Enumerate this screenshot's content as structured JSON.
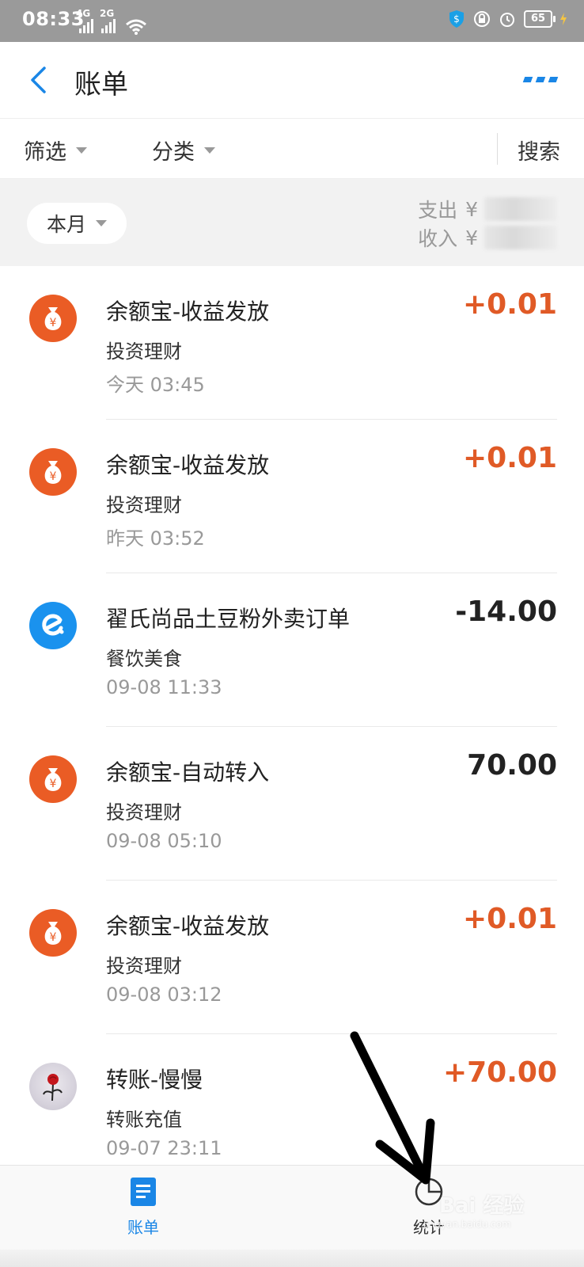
{
  "status_bar": {
    "time": "08:33",
    "sim1": "4G",
    "sim2": "2G",
    "battery": "65",
    "icons": [
      "shield-icon",
      "lock-icon",
      "alarm-icon",
      "battery-icon"
    ]
  },
  "header": {
    "title": "账单",
    "back_icon": "back-chevron-icon",
    "more_icon": "more-icon"
  },
  "filters": {
    "filter_label": "筛选",
    "category_label": "分类",
    "search_label": "搜索"
  },
  "summary": {
    "month_label": "本月",
    "expense_label": "支出",
    "expense_currency": "¥",
    "income_label": "收入",
    "income_currency": "¥"
  },
  "transactions": [
    {
      "name": "余额宝-收益发放",
      "category": "投资理财",
      "time": "今天  03:45",
      "amount": "+0.01",
      "icon": "money-bag-icon",
      "kind": "income"
    },
    {
      "name": "余额宝-收益发放",
      "category": "投资理财",
      "time": "昨天  03:52",
      "amount": "+0.01",
      "icon": "money-bag-icon",
      "kind": "income"
    },
    {
      "name": "翟氏尚品土豆粉外卖订单",
      "category": "餐饮美食",
      "time": "09-08  11:33",
      "amount": "-14.00",
      "icon": "eleme-icon",
      "kind": "expense"
    },
    {
      "name": "余额宝-自动转入",
      "category": "投资理财",
      "time": "09-08  05:10",
      "amount": "70.00",
      "icon": "money-bag-icon",
      "kind": "neutral"
    },
    {
      "name": "余额宝-收益发放",
      "category": "投资理财",
      "time": "09-08  03:12",
      "amount": "+0.01",
      "icon": "money-bag-icon",
      "kind": "income"
    },
    {
      "name": "转账-慢慢",
      "category": "转账充值",
      "time": "09-07  23:11",
      "amount": "+70.00",
      "icon": "avatar-rose",
      "kind": "income"
    }
  ],
  "bottom_nav": {
    "tab_bill": "账单",
    "tab_stats": "统计"
  },
  "watermark": {
    "brand": "Bai 经验",
    "url": "jingyan.baidu.com"
  },
  "colors": {
    "accent": "#1a86e6",
    "income": "#e05a26",
    "orange_icon": "#ea5c25",
    "blue_icon": "#1a92ee"
  }
}
